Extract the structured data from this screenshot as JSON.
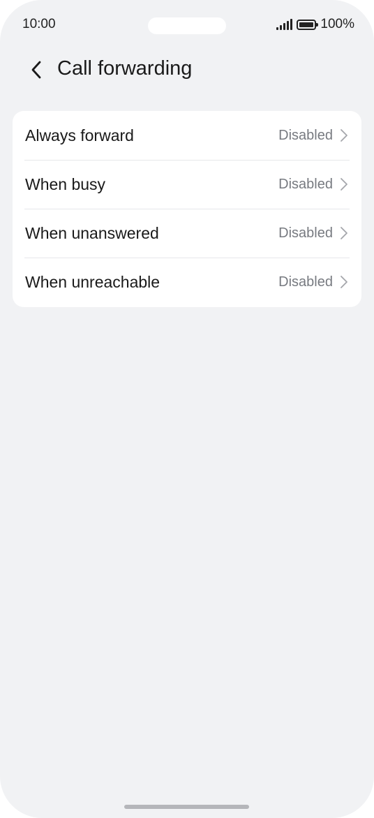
{
  "status_bar": {
    "time": "10:00",
    "battery": "100%"
  },
  "header": {
    "title": "Call forwarding",
    "back_icon": "chevron-left-icon"
  },
  "items": [
    {
      "label": "Always forward",
      "value": "Disabled"
    },
    {
      "label": "When busy",
      "value": "Disabled"
    },
    {
      "label": "When unanswered",
      "value": "Disabled"
    },
    {
      "label": "When unreachable",
      "value": "Disabled"
    }
  ],
  "colors": {
    "background": "#f1f2f4",
    "card": "#ffffff",
    "text_primary": "#1a1a1a",
    "text_secondary": "#777a80"
  }
}
